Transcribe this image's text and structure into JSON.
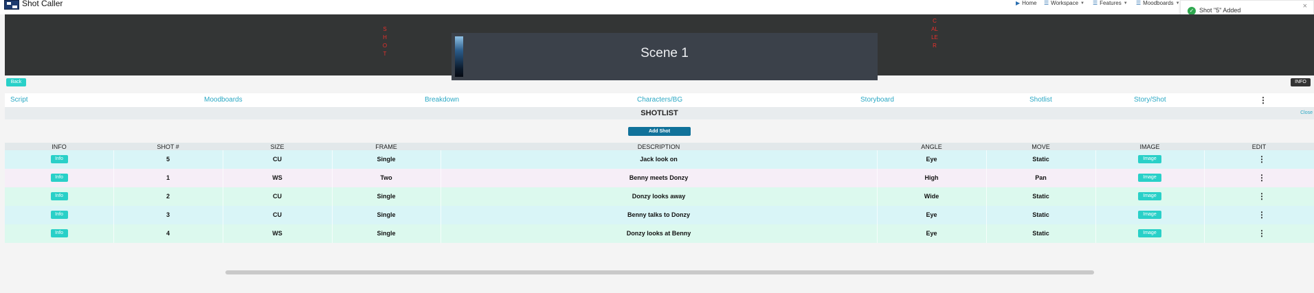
{
  "app": {
    "brand": "Shot Caller"
  },
  "nav": {
    "home": "Home",
    "workspace": "Workspace",
    "features": "Features",
    "moodboards": "Moodboards"
  },
  "toast": {
    "message": "Shot \"5\" Added",
    "close": "×",
    "progress_fraction": 0.2
  },
  "banner": {
    "left_vertical": "SHOT",
    "right_vertical": "CALLER",
    "scene_title": "Scene 1"
  },
  "buttons": {
    "back": "Back",
    "info": "INFO",
    "add_shot": "Add Shot",
    "close": "Close"
  },
  "tabs": [
    "Script",
    "Moodboards",
    "Breakdown",
    "Characters/BG",
    "Storyboard",
    "Shotlist",
    "Story/Shot"
  ],
  "section": {
    "title": "SHOTLIST"
  },
  "table": {
    "headers": [
      "INFO",
      "SHOT #",
      "SIZE",
      "FRAME",
      "DESCRIPTION",
      "ANGLE",
      "MOVE",
      "IMAGE",
      "EDIT"
    ],
    "info_label": "Info",
    "image_label": "Image",
    "rows": [
      {
        "shot": "5",
        "size": "CU",
        "frame": "Single",
        "description": "Jack look on",
        "angle": "Eye",
        "move": "Static"
      },
      {
        "shot": "1",
        "size": "WS",
        "frame": "Two",
        "description": "Benny meets Donzy",
        "angle": "High",
        "move": "Pan"
      },
      {
        "shot": "2",
        "size": "CU",
        "frame": "Single",
        "description": "Donzy looks away",
        "angle": "Wide",
        "move": "Static"
      },
      {
        "shot": "3",
        "size": "CU",
        "frame": "Single",
        "description": "Benny talks to Donzy",
        "angle": "Eye",
        "move": "Static"
      },
      {
        "shot": "4",
        "size": "WS",
        "frame": "Single",
        "description": "Donzy looks at Benny",
        "angle": "Eye",
        "move": "Static"
      }
    ],
    "row_colors": [
      "#d9f5f7",
      "#f6eef7",
      "#dcf9ee",
      "#d9f5f7",
      "#dcf9ee"
    ]
  },
  "colors": {
    "accent": "#29d0c8",
    "primary_button": "#11729a",
    "success": "#2fa84f",
    "banner_text": "#e8302c"
  }
}
